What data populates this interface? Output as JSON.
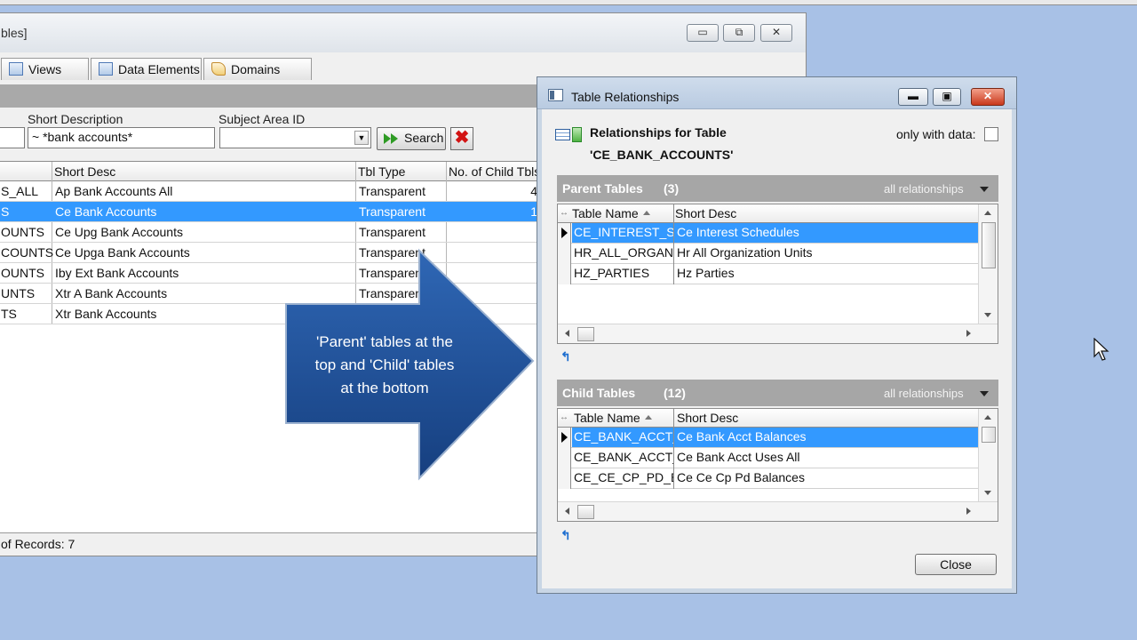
{
  "main_window": {
    "title_fragment": "bles]",
    "controls": {
      "minimize": "▭",
      "restore": "⧉",
      "close": "✕"
    },
    "tabs": [
      {
        "label": "Views",
        "icon": "grid-icon"
      },
      {
        "label": "Data Elements",
        "icon": "columns-icon"
      },
      {
        "label": "Domains",
        "icon": "book-icon"
      }
    ],
    "filters": {
      "short_desc_label": "Short Description",
      "short_desc_value": "~  *bank accounts*",
      "subject_area_label": "Subject Area ID",
      "subject_area_value": "",
      "search_label": "Search",
      "clear_label": "✖"
    },
    "grid": {
      "headers": [
        "Short Desc",
        "Tbl Type",
        "No. of Child Tbls"
      ],
      "rows": [
        {
          "name": "S_ALL",
          "desc": "Ap Bank Accounts All",
          "type": "Transparent",
          "child": "4"
        },
        {
          "name": "S",
          "desc": "Ce Bank Accounts",
          "type": "Transparent",
          "child": "1"
        },
        {
          "name": "OUNTS",
          "desc": "Ce Upg Bank Accounts",
          "type": "Transparent",
          "child": ""
        },
        {
          "name": "COUNTS",
          "desc": "Ce Upga Bank Accounts",
          "type": "Transparent",
          "child": ""
        },
        {
          "name": "OUNTS",
          "desc": "Iby Ext Bank Accounts",
          "type": "Transparent",
          "child": ""
        },
        {
          "name": "UNTS",
          "desc": "Xtr A Bank Accounts",
          "type": "Transparent",
          "child": ""
        },
        {
          "name": "TS",
          "desc": "Xtr Bank Accounts",
          "type": "",
          "child": ""
        }
      ],
      "selected_index": 1
    },
    "status": "of Records: 7"
  },
  "callout": {
    "lines": [
      "'Parent' tables at the",
      "top and 'Child' tables",
      "at the bottom"
    ]
  },
  "dialog": {
    "title": "Table Relationships",
    "controls": {
      "minimize": "▬",
      "restore": "▣",
      "close": "✕"
    },
    "heading": "Relationships for Table",
    "table_name": "'CE_BANK_ACCOUNTS'",
    "only_with_data_label": "only with data:",
    "parent": {
      "title": "Parent Tables",
      "count": "(3)",
      "filter": "all relationships",
      "headers": [
        "Table Name",
        "Short Desc"
      ],
      "rows": [
        {
          "name": "CE_INTEREST_SCI",
          "desc": "Ce Interest Schedules"
        },
        {
          "name": "HR_ALL_ORGANIZ",
          "desc": "Hr All Organization Units"
        },
        {
          "name": "HZ_PARTIES",
          "desc": "Hz Parties"
        }
      ]
    },
    "child": {
      "title": "Child Tables",
      "count": "(12)",
      "filter": "all relationships",
      "headers": [
        "Table Name",
        "Short Desc"
      ],
      "rows": [
        {
          "name": "CE_BANK_ACCT_E",
          "desc": "Ce Bank Acct Balances"
        },
        {
          "name": "CE_BANK_ACCT_U",
          "desc": "Ce Bank Acct Uses All"
        },
        {
          "name": "CE_CE_CP_PD_BA",
          "desc": "Ce Ce Cp Pd Balances"
        }
      ]
    },
    "nav_icon": "↰",
    "close_label": "Close"
  },
  "colors": {
    "desktop": "#a8c1e6",
    "selection": "#3399ff",
    "callout": "#1f4f96",
    "section_header": "#a6a6a6"
  }
}
